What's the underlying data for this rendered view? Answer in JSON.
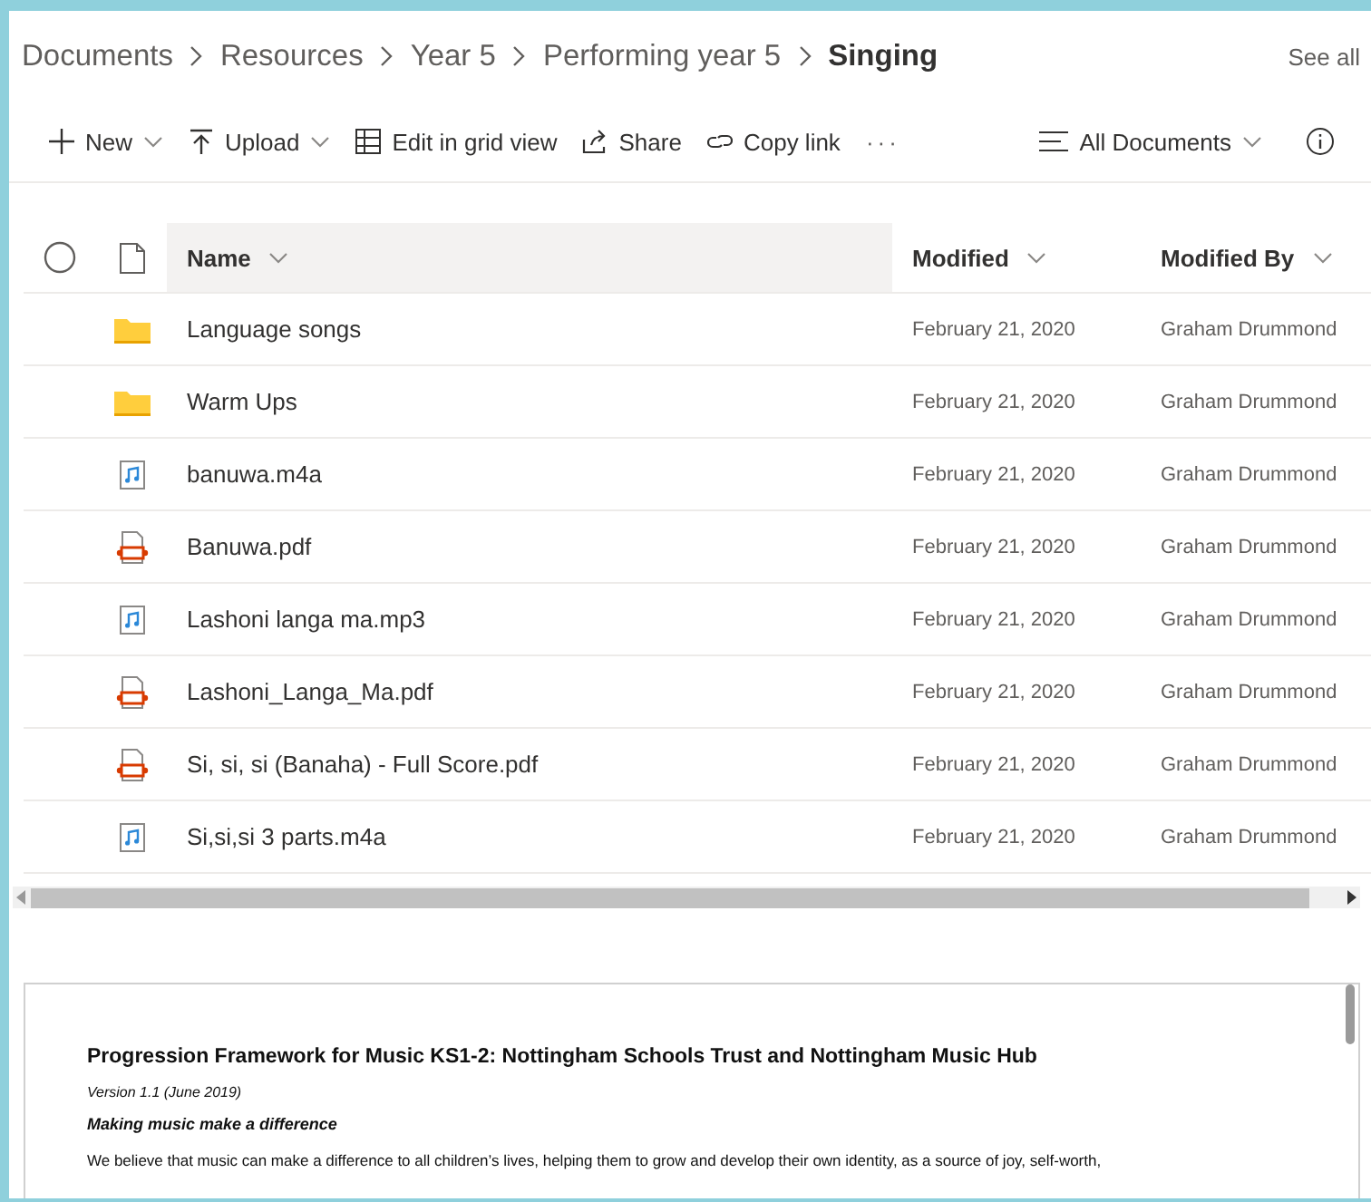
{
  "breadcrumb": [
    {
      "label": "Documents",
      "current": false
    },
    {
      "label": "Resources",
      "current": false
    },
    {
      "label": "Year 5",
      "current": false
    },
    {
      "label": "Performing year 5",
      "current": false
    },
    {
      "label": "Singing",
      "current": true
    }
  ],
  "see_all": "See all",
  "toolbar": [
    {
      "kind": "new",
      "label": "New",
      "dropdown": true
    },
    {
      "kind": "upload",
      "label": "Upload",
      "dropdown": true
    },
    {
      "kind": "grid",
      "label": "Edit in grid view",
      "dropdown": false
    },
    {
      "kind": "share",
      "label": "Share",
      "dropdown": false
    },
    {
      "kind": "link",
      "label": "Copy link",
      "dropdown": false
    },
    {
      "kind": "more",
      "label": "···",
      "dropdown": false
    }
  ],
  "view": {
    "label": "All Documents"
  },
  "table": {
    "columns": [
      {
        "label": "Name",
        "sorted": true
      },
      {
        "label": "Modified",
        "sorted": false
      },
      {
        "label": "Modified By",
        "sorted": false
      }
    ],
    "rows": [
      {
        "kind": "folder",
        "name": "Language songs",
        "modified": "February 21, 2020",
        "modified_by": "Graham Drummond"
      },
      {
        "kind": "folder",
        "name": "Warm Ups",
        "modified": "February 21, 2020",
        "modified_by": "Graham Drummond"
      },
      {
        "kind": "audio",
        "name": "banuwa.m4a",
        "modified": "February 21, 2020",
        "modified_by": "Graham Drummond"
      },
      {
        "kind": "pdf",
        "name": "Banuwa.pdf",
        "modified": "February 21, 2020",
        "modified_by": "Graham Drummond"
      },
      {
        "kind": "audio",
        "name": "Lashoni langa ma.mp3",
        "modified": "February 21, 2020",
        "modified_by": "Graham Drummond"
      },
      {
        "kind": "pdf",
        "name": "Lashoni_Langa_Ma.pdf",
        "modified": "February 21, 2020",
        "modified_by": "Graham Drummond"
      },
      {
        "kind": "pdf",
        "name": "Si, si, si (Banaha) - Full Score.pdf",
        "modified": "February 21, 2020",
        "modified_by": "Graham Drummond"
      },
      {
        "kind": "audio",
        "name": "Si,si,si 3 parts.m4a",
        "modified": "February 21, 2020",
        "modified_by": "Graham Drummond"
      }
    ]
  },
  "document": {
    "title": "Progression Framework for Music KS1-2: Nottingham Schools Trust and Nottingham Music Hub",
    "version": "Version 1.1 (June 2019)",
    "subtitle": "Making music make a difference",
    "paragraph": "We believe that music can make a difference to all children’s lives, helping them to grow and develop their own identity, as a source of joy, self-worth,"
  }
}
